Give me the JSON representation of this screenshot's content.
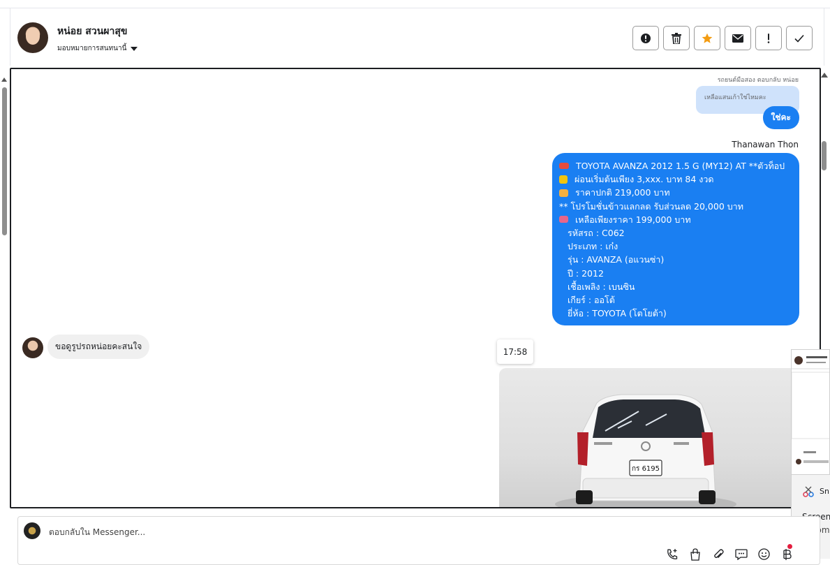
{
  "header": {
    "contact_name": "หน่อย สวนผาสุข",
    "assign_label": "มอบหมายการสนทนานี้",
    "actions": [
      {
        "name": "report-button",
        "icon": "alert-circle-icon"
      },
      {
        "name": "delete-button",
        "icon": "trash-icon"
      },
      {
        "name": "star-button",
        "icon": "star-icon"
      },
      {
        "name": "mark-unread-button",
        "icon": "envelope-icon"
      },
      {
        "name": "mark-spam-button",
        "icon": "exclamation-icon"
      },
      {
        "name": "mark-done-button",
        "icon": "check-icon"
      }
    ]
  },
  "chat": {
    "reply_ref": "รถยนต์มือสอง ตอบกลับ หน่อย",
    "quoted_text": "เหลือแสนเก้าใช่ไหมคะ",
    "reply_text": "ใช่คะ",
    "sender_name": "Thanawan Thon",
    "listing": {
      "title": "TOYOTA AVANZA 2012 1.5 G (MY12) AT **ตัวท็อป",
      "installment": "ผ่อนเริ่มต้นเพียง 3,xxx. บาท 84 งวด",
      "normal_price": "ราคาปกติ 219,000 บาท",
      "promo": "** โปรโมชั่นข้าวแลกลด รับส่วนลด 20,000 บาท",
      "final_price": "เหลือเพียงราคา 199,000 บาท",
      "code": "รหัสรถ : C062",
      "type": "ประเภท : เก๋ง",
      "model": "รุ่น : AVANZA (อแวนซ่า)",
      "year": "ปี : 2012",
      "fuel": "เชื้อเพลิง : เบนซิน",
      "gear": "เกียร์ : ออโต้",
      "brand": "ยี่ห้อ : TOYOTA (โตโยต้า)"
    },
    "incoming_text": "ขอดูรูปรถหน่อยคะสนใจ",
    "timestamp": "17:58",
    "photo": {
      "plate": "กร 6195"
    }
  },
  "snip_popup": {
    "title": "Snipping Tool",
    "line1": "Screenshot copied to clipboard",
    "line2": "Automatically saved to screenshots folder"
  },
  "composer": {
    "placeholder": "ตอบกลับใน Messenger...",
    "tools": [
      "phone-plus-icon",
      "shopping-bag-icon",
      "paperclip-icon",
      "chat-bubble-icon",
      "emoji-icon",
      "baht-icon"
    ]
  }
}
